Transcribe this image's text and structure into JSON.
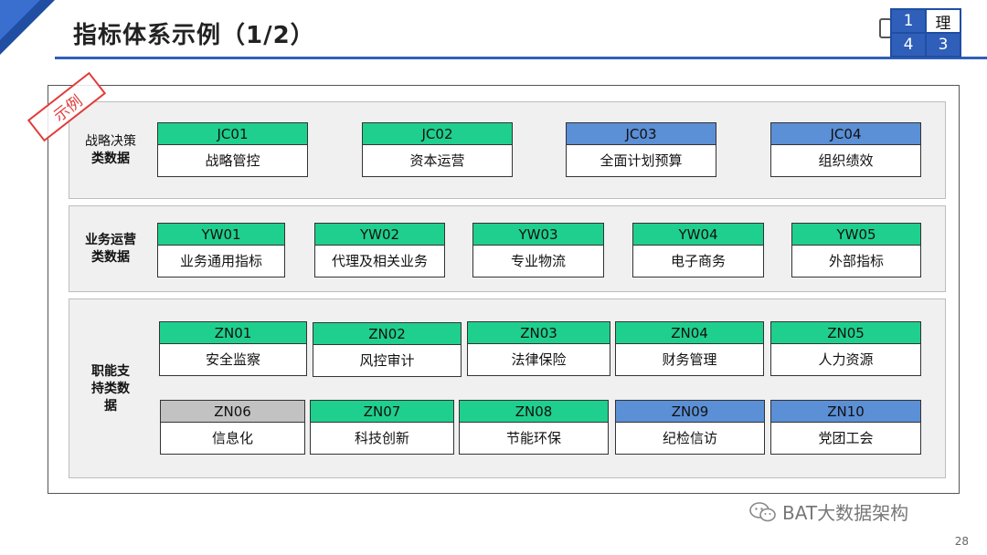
{
  "title": "指标体系示例（1/2）",
  "logo": {
    "cells": [
      "1",
      "理",
      "4",
      "3"
    ]
  },
  "stamp": "示例",
  "rows": [
    {
      "label_lines": [
        "战略决策",
        "类数据"
      ],
      "tiles": [
        {
          "code": "JC01",
          "name": "战略管控",
          "color": "green"
        },
        {
          "code": "JC02",
          "name": "资本运营",
          "color": "green"
        },
        {
          "code": "JC03",
          "name": "全面计划预算",
          "color": "blue"
        },
        {
          "code": "JC04",
          "name": "组织绩效",
          "color": "blue"
        }
      ]
    },
    {
      "label_lines": [
        "业务运营",
        "类数据"
      ],
      "tiles": [
        {
          "code": "YW01",
          "name": "业务通用指标",
          "color": "green"
        },
        {
          "code": "YW02",
          "name": "代理及相关业务",
          "color": "green"
        },
        {
          "code": "YW03",
          "name": "专业物流",
          "color": "green"
        },
        {
          "code": "YW04",
          "name": "电子商务",
          "color": "green"
        },
        {
          "code": "YW05",
          "name": "外部指标",
          "color": "green"
        }
      ]
    },
    {
      "label_lines": [
        "职能支",
        "持类数",
        "据"
      ],
      "tiles": [
        {
          "code": "ZN01",
          "name": "安全监察",
          "color": "green"
        },
        {
          "code": "ZN02",
          "name": "风控审计",
          "color": "green"
        },
        {
          "code": "ZN03",
          "name": "法律保险",
          "color": "green"
        },
        {
          "code": "ZN04",
          "name": "财务管理",
          "color": "green"
        },
        {
          "code": "ZN05",
          "name": "人力资源",
          "color": "green"
        },
        {
          "code": "ZN06",
          "name": "信息化",
          "color": "gray"
        },
        {
          "code": "ZN07",
          "name": "科技创新",
          "color": "green"
        },
        {
          "code": "ZN08",
          "name": "节能环保",
          "color": "green"
        },
        {
          "code": "ZN09",
          "name": "纪检信访",
          "color": "blue"
        },
        {
          "code": "ZN10",
          "name": "党团工会",
          "color": "blue"
        }
      ]
    }
  ],
  "brand": "BAT大数据架构",
  "page_number": "28",
  "colors": {
    "green": "#1fcf8e",
    "blue": "#5b8fd6",
    "gray": "#c2c2c2",
    "accent": "#2f5fb8",
    "stamp": "#e23b3b"
  }
}
